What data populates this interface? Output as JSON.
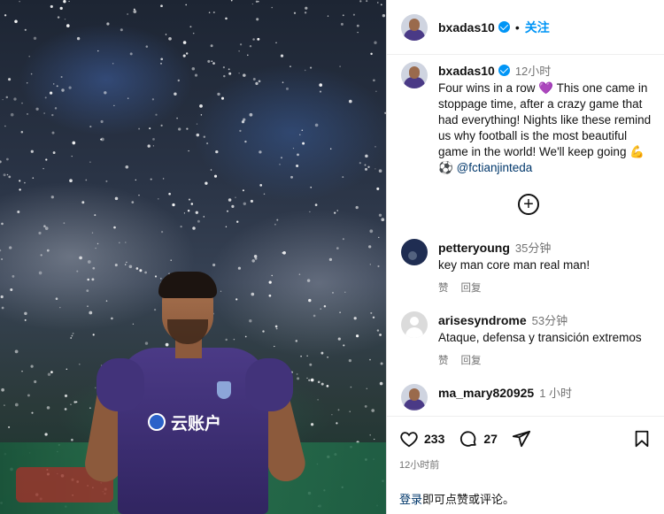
{
  "post": {
    "username": "bxadas10",
    "follow_label": "关注",
    "separator": "•"
  },
  "caption": {
    "username": "bxadas10",
    "time": "12小时",
    "text": "Four wins in a row 💜 This one came in stoppage time, after a crazy game that had everything! Nights like these remind us why football is the most beautiful game in the world! We'll keep going 💪⚽ ",
    "mention": "@fctianjinteda"
  },
  "add_comments_symbol": "+",
  "photo": {
    "jersey_sponsor": "云账户"
  },
  "comments": [
    {
      "username": "petteryoung",
      "time": "35分钟",
      "text": "key man core man real man!",
      "like_label": "赞",
      "reply_label": "回复",
      "avatar": "dark-photo"
    },
    {
      "username": "arisesyndrome",
      "time": "53分钟",
      "text": "Ataque, defensa y transición extremos",
      "like_label": "赞",
      "reply_label": "回复",
      "avatar": "default-gray"
    },
    {
      "username": "ma_mary820925",
      "time": "1 小时",
      "text": "",
      "avatar": "player-photo"
    }
  ],
  "actions": {
    "likes": "233",
    "comments": "27",
    "icons": [
      "heart-icon",
      "comment-icon",
      "share-icon",
      "bookmark-icon"
    ]
  },
  "posted_time": "12小时前",
  "login_prompt": {
    "link": "登录",
    "rest": "即可点赞或评论。"
  },
  "colors": {
    "accent": "#0095f6",
    "link": "#00376b",
    "muted": "#737373",
    "jersey": "#3b2d70"
  }
}
